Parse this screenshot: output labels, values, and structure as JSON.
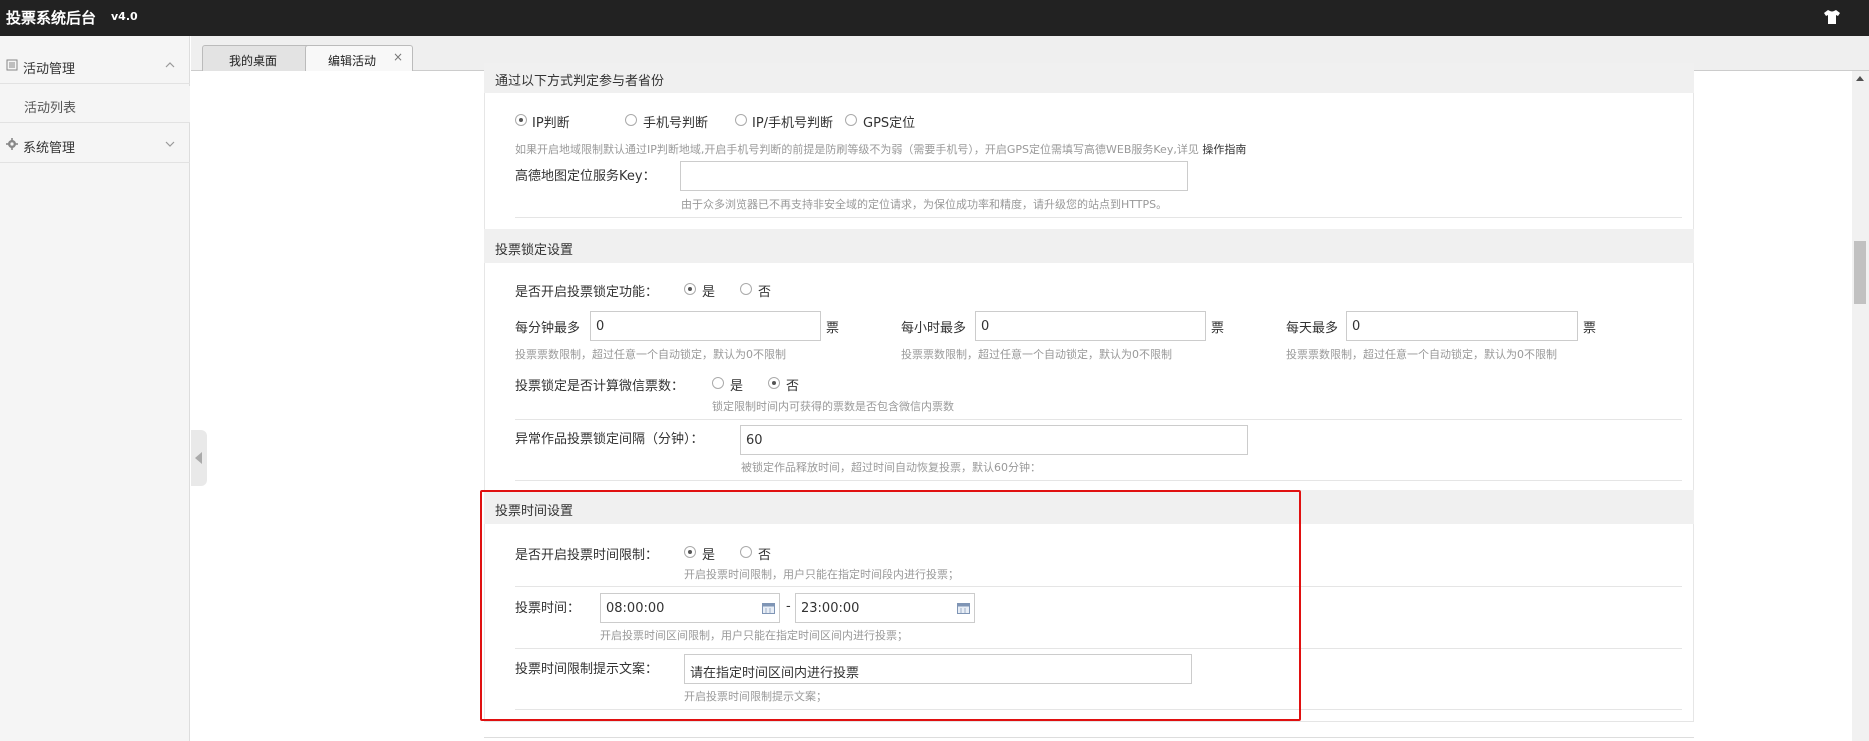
{
  "app": {
    "title": "投票系统后台",
    "version": "v4.0"
  },
  "sidebar": {
    "groups": [
      {
        "label": "活动管理"
      },
      {
        "label": "系统管理"
      }
    ],
    "sub_items": [
      {
        "label": "活动列表"
      }
    ]
  },
  "tabs": [
    {
      "label": "我的桌面"
    },
    {
      "label": "编辑活动",
      "close": "×"
    }
  ],
  "region": {
    "header": "通过以下方式判定参与者省份",
    "options": [
      "IP判断",
      "手机号判断",
      "IP/手机号判断",
      "GPS定位"
    ],
    "selected": "IP判断",
    "hint_text": "如果开启地域限制默认通过IP判断地域,开启手机号判断的前提是防刷等级不为弱（需要手机号），开启GPS定位需填写高德WEB服务Key,详见",
    "hint_link": "操作指南",
    "amap_label": "高德地图定位服务Key：",
    "amap_value": "",
    "amap_hint": "由于众多浏览器已不再支持非安全域的定位请求，为保位成功率和精度，请升级您的站点到HTTPS。"
  },
  "lock": {
    "header": "投票锁定设置",
    "enable_label": "是否开启投票锁定功能：",
    "yes": "是",
    "no": "否",
    "enable_selected": "是",
    "per_minute_label": "每分钟最多",
    "per_minute_value": "0",
    "per_hour_label": "每小时最多",
    "per_hour_value": "0",
    "per_day_label": "每天最多",
    "per_day_value": "0",
    "unit": "票",
    "limit_hint": "投票票数限制，超过任意一个自动锁定，默认为0不限制",
    "wechat_label": "投票锁定是否计算微信票数：",
    "wechat_selected": "否",
    "wechat_hint": "锁定限制时间内可获得的票数是否包含微信内票数",
    "interval_label": "异常作品投票锁定间隔（分钟）：",
    "interval_value": "60",
    "interval_hint": "被锁定作品释放时间，超过时间自动恢复投票，默认60分钟："
  },
  "time": {
    "header": "投票时间设置",
    "enable_label": "是否开启投票时间限制：",
    "yes": "是",
    "no": "否",
    "enable_selected": "是",
    "enable_hint": "开启投票时间限制，用户只能在指定时间段内进行投票；",
    "range_label": "投票时间：",
    "start": "08:00:00",
    "separator": "-",
    "end": "23:00:00",
    "range_hint": "开启投票时间区间限制，用户只能在指定时间区间内进行投票；",
    "tip_label": "投票时间限制提示文案：",
    "tip_value": "请在指定时间区间内进行投票",
    "tip_hint": "开启投票时间限制提示文案；"
  },
  "colors": {
    "highlight": "#e01010",
    "topbar": "#222222"
  }
}
